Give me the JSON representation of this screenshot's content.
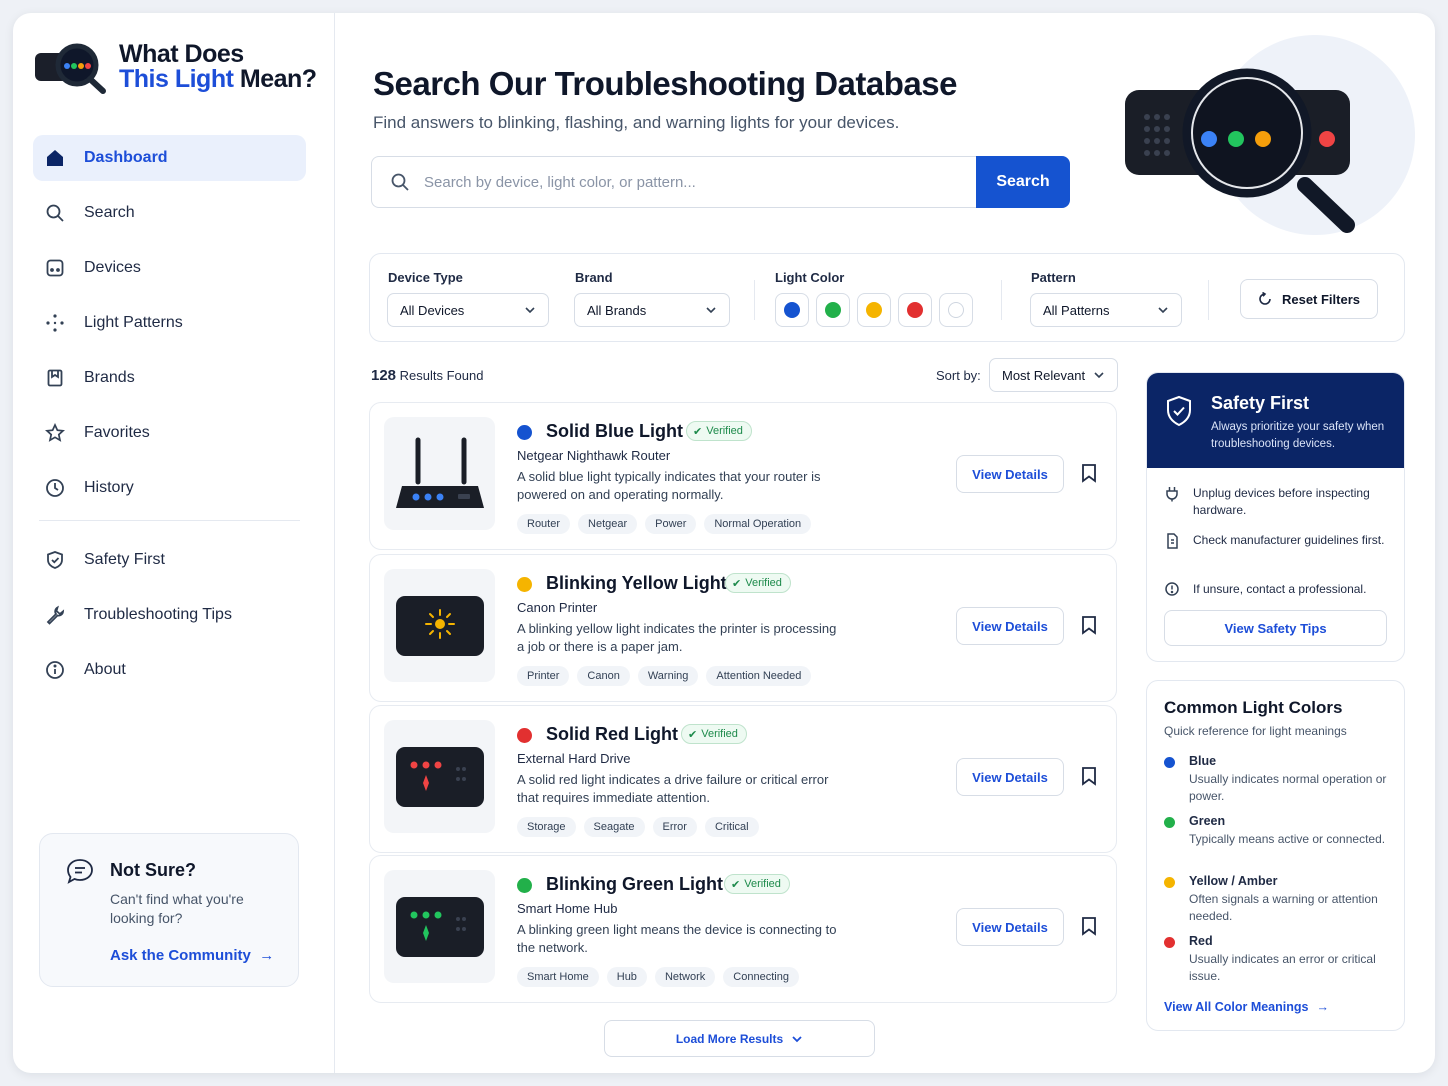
{
  "app": {
    "logo_line1": "What Does",
    "logo_line2_a": "This Light",
    "logo_line2_b": " Mean?"
  },
  "sidebar": {
    "items": [
      {
        "label": "Dashboard",
        "icon": "home-icon",
        "active": true
      },
      {
        "label": "Search",
        "icon": "search-icon"
      },
      {
        "label": "Devices",
        "icon": "device-icon"
      },
      {
        "label": "Light Patterns",
        "icon": "pattern-icon"
      },
      {
        "label": "Brands",
        "icon": "bookmark-icon"
      },
      {
        "label": "Favorites",
        "icon": "star-icon"
      },
      {
        "label": "History",
        "icon": "clock-icon"
      }
    ],
    "secondary": [
      {
        "label": "Safety First",
        "icon": "shield-icon"
      },
      {
        "label": "Troubleshooting Tips",
        "icon": "wrench-icon"
      },
      {
        "label": "About",
        "icon": "info-icon"
      }
    ],
    "help": {
      "title": "Not Sure?",
      "description": "Can't find what you're looking for?",
      "link": "Ask the Community"
    }
  },
  "header": {
    "title": "Search Our Troubleshooting Database",
    "subtitle": "Find answers to blinking, flashing, and warning lights for your devices."
  },
  "search": {
    "placeholder": "Search by device, light color, or pattern...",
    "value": "",
    "button": "Search"
  },
  "filters": {
    "device_type": {
      "label": "Device Type",
      "value": "All Devices"
    },
    "brand": {
      "label": "Brand",
      "value": "All Brands"
    },
    "light_color": {
      "label": "Light Color",
      "swatches": [
        "#1553d0",
        "#22b04a",
        "#f5b400",
        "#e23030",
        "#ffffff"
      ]
    },
    "pattern": {
      "label": "Pattern",
      "value": "All Patterns"
    },
    "reset": "Reset Filters"
  },
  "results": {
    "count": "128",
    "count_label": "Results Found",
    "sort_label": "Sort by:",
    "sort_value": "Most Relevant",
    "items": [
      {
        "title": "Solid Blue Light",
        "color": "#1553d0",
        "badge": "Verified",
        "device": "Netgear Nighthawk Router",
        "description": "A solid blue light typically indicates that your router is powered on and operating normally.",
        "tags": [
          "Router",
          "Netgear",
          "Power",
          "Normal Operation"
        ],
        "action": "View Details"
      },
      {
        "title": "Blinking Yellow Light",
        "color": "#f5b400",
        "badge": "Verified",
        "device": "Canon Printer",
        "description": "A blinking yellow light indicates the printer is processing a job or there is a paper jam.",
        "tags": [
          "Printer",
          "Canon",
          "Warning",
          "Attention Needed"
        ],
        "action": "View Details"
      },
      {
        "title": "Solid Red Light",
        "color": "#e23030",
        "badge": "Verified",
        "device": "External Hard Drive",
        "description": "A solid red light indicates a drive failure or critical error that requires immediate attention.",
        "tags": [
          "Storage",
          "Seagate",
          "Error",
          "Critical"
        ],
        "action": "View Details"
      },
      {
        "title": "Blinking Green Light",
        "color": "#22b04a",
        "badge": "Verified",
        "device": "Smart Home Hub",
        "description": "A blinking green light means the device is connecting to the network.",
        "tags": [
          "Smart Home",
          "Hub",
          "Network",
          "Connecting"
        ],
        "action": "View Details"
      }
    ],
    "load_more": "Load More Results"
  },
  "safety": {
    "title": "Safety First",
    "description": "Always prioritize your safety when troubleshooting devices.",
    "tips": [
      "Unplug devices before inspecting hardware.",
      "Check manufacturer guidelines first.",
      "If unsure, contact a professional."
    ],
    "button": "View Safety Tips"
  },
  "colors_ref": {
    "title": "Common Light Colors",
    "subtitle": "Quick reference for light meanings",
    "items": [
      {
        "name": "Blue",
        "color": "#1553d0",
        "meaning": "Usually indicates normal operation or power."
      },
      {
        "name": "Green",
        "color": "#22b04a",
        "meaning": "Typically means active or connected."
      },
      {
        "name": "Yellow / Amber",
        "color": "#f5b400",
        "meaning": "Often signals a warning or attention needed."
      },
      {
        "name": "Red",
        "color": "#e23030",
        "meaning": "Usually indicates an error or critical issue."
      }
    ],
    "link": "View All Color Meanings"
  }
}
